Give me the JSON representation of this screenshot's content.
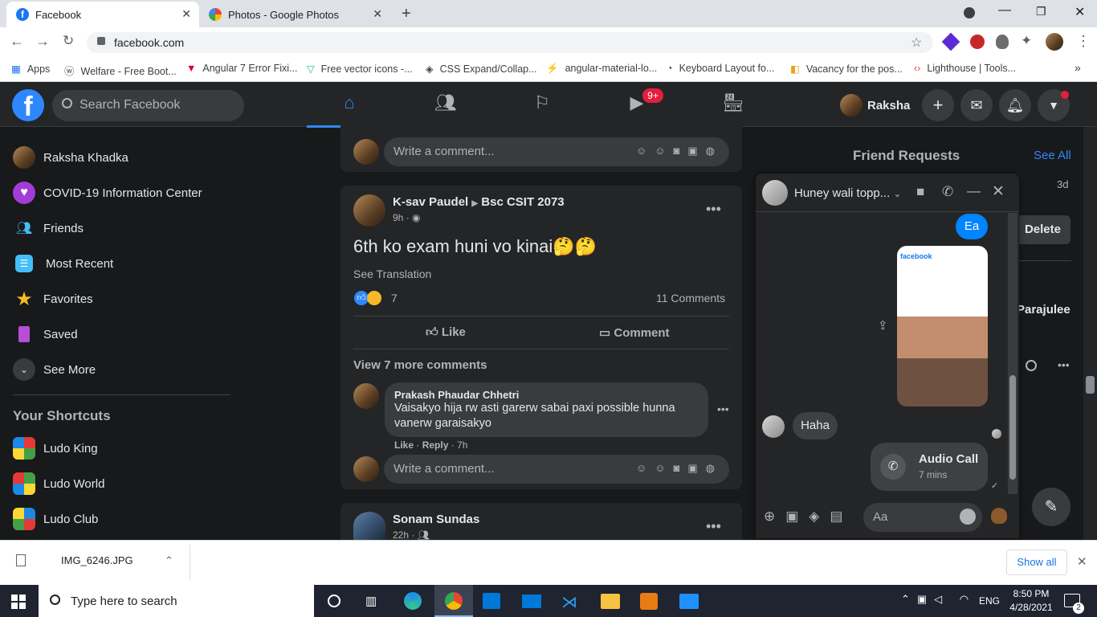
{
  "browser": {
    "tabs": [
      {
        "title": "Facebook"
      },
      {
        "title": "Photos - Google Photos"
      }
    ],
    "url": "facebook.com",
    "bookmarks": [
      "Apps",
      "Welfare - Free Boot...",
      "Angular 7 Error Fixi...",
      "Free vector icons -...",
      "CSS Expand/Collap...",
      "angular-material-lo...",
      "Keyboard Layout fo...",
      "Vacancy for the pos...",
      "Lighthouse  |  Tools..."
    ]
  },
  "header": {
    "search_placeholder": "Search Facebook",
    "watch_badge": "9+",
    "profile_name": "Raksha"
  },
  "sidebar": {
    "items": [
      {
        "label": "Raksha Khadka"
      },
      {
        "label": "COVID-19 Information Center"
      },
      {
        "label": "Friends"
      },
      {
        "label": "Most Recent"
      },
      {
        "label": "Favorites"
      },
      {
        "label": "Saved"
      },
      {
        "label": "See More"
      }
    ],
    "shortcuts_title": "Your Shortcuts",
    "shortcuts": [
      {
        "label": "Ludo King"
      },
      {
        "label": "Ludo World"
      },
      {
        "label": "Ludo Club"
      }
    ]
  },
  "feed": {
    "comment_placeholder": "Write a comment...",
    "post": {
      "author": "K-sav Paudel",
      "group": "Bsc CSIT 2073",
      "time": "9h",
      "text": "6th ko exam huni vo kinai🤔🤔",
      "see_translation": "See Translation",
      "reactions_count": "7",
      "comments_count": "11 Comments",
      "like_label": "Like",
      "comment_label": "Comment",
      "view_more": "View 7 more comments",
      "comment": {
        "author": "Prakash Phaudar Chhetri",
        "text": "Vaisakyo hija rw asti garerw sabai paxi possible hunna vanerw garaisakyo",
        "like": "Like",
        "reply": "Reply",
        "time": "7h"
      }
    },
    "next_post": {
      "author": "Sonam Sundas",
      "time": "22h"
    }
  },
  "right": {
    "friend_requests": "Friend Requests",
    "see_all": "See All",
    "req_time": "3d",
    "delete": "Delete",
    "contact_partial": "Parajulee"
  },
  "chat": {
    "name": "Huney wali topp...",
    "msg_sent": "Ea",
    "msg_received": "Haha",
    "call_title": "Audio Call",
    "call_duration": "7 mins",
    "input_placeholder": "Aa"
  },
  "downloads": {
    "file": "IMG_6246.JPG",
    "show_all": "Show all"
  },
  "taskbar": {
    "search_placeholder": "Type here to search",
    "lang": "ENG",
    "time": "8:50 PM",
    "date": "4/28/2021",
    "notif_count": "2"
  }
}
